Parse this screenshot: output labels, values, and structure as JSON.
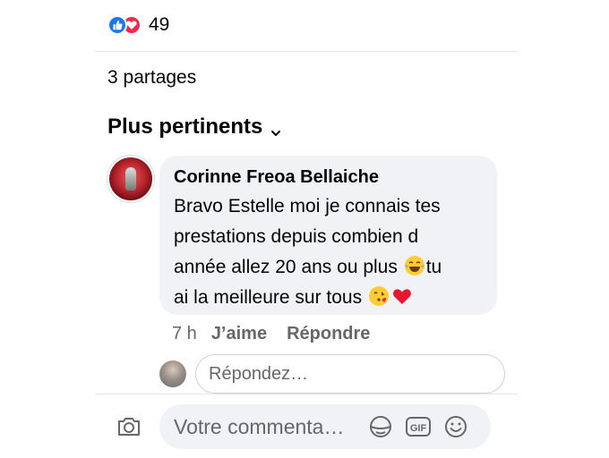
{
  "reactions": {
    "count": "49",
    "icons": [
      "like-icon",
      "love-icon"
    ],
    "colors": {
      "like": "#1877f2",
      "love": "#f0284a"
    }
  },
  "shares": {
    "label": "3 partages"
  },
  "sort": {
    "label": "Plus pertinents",
    "icon": "chevron-down-icon"
  },
  "comment": {
    "author": "Corinne Freoa Bellaiche",
    "text_line1": "Bravo Estelle moi je connais tes",
    "text_line2": "prestations depuis combien d",
    "text_line3": "année allez 20 ans ou plus",
    "text_line3b": "tu",
    "text_line4": "ai la meilleure sur tous",
    "emojis": [
      "tears-of-joy-emoji",
      "kissing-heart-emoji",
      "red-heart-emoji"
    ],
    "time": "7 h",
    "like_label": "J’aime",
    "reply_label": "Répondre"
  },
  "reply": {
    "placeholder": "Répondez…"
  },
  "composer": {
    "placeholder": "Votre commenta…",
    "icons": [
      "camera-icon",
      "sticker-icon",
      "gif-icon",
      "emoji-icon"
    ]
  }
}
